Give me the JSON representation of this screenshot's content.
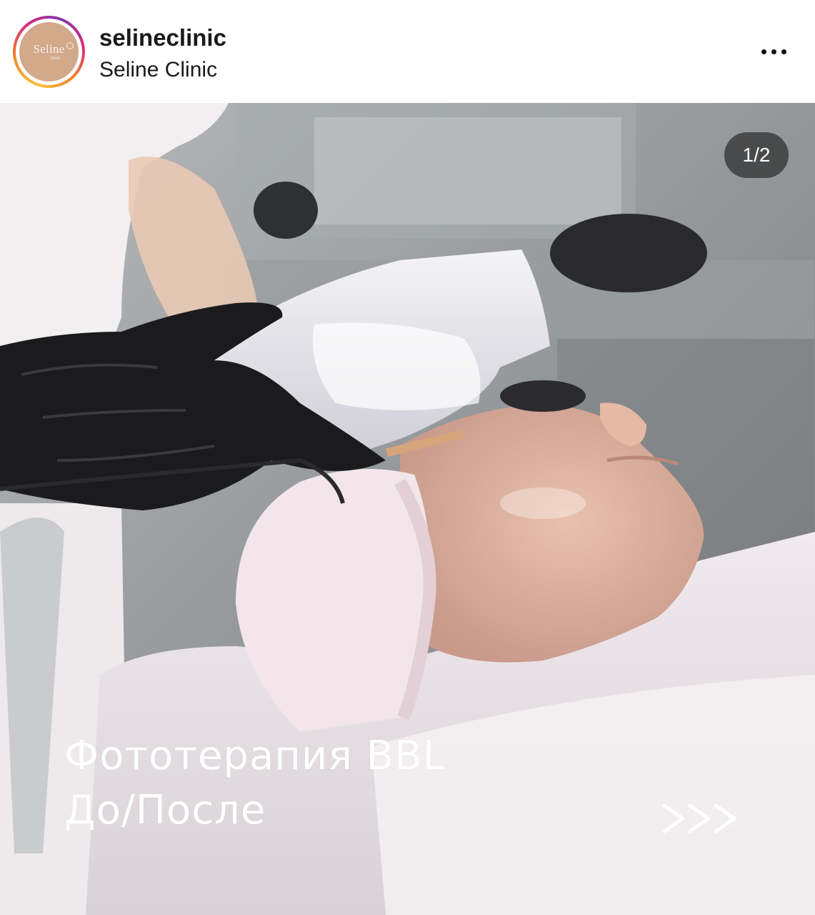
{
  "post": {
    "username": "selineclinic",
    "display_name": "Seline Clinic",
    "avatar_logo": {
      "text": "Seline",
      "sub": "clinic"
    },
    "more_icon": "more-horizontal-icon"
  },
  "carousel": {
    "counter": "1/2"
  },
  "image": {
    "caption_line1": "Фототерапия BBL",
    "caption_line2": "До/После",
    "arrows_text": ">>>",
    "arrows_icon": "next-arrows-icon"
  },
  "colors": {
    "story_ring": [
      "#f9c13a",
      "#f58529",
      "#dd2a7b",
      "#8134af"
    ],
    "avatar_bg": "#d2a98b",
    "counter_bg": "#2d2d2d"
  }
}
